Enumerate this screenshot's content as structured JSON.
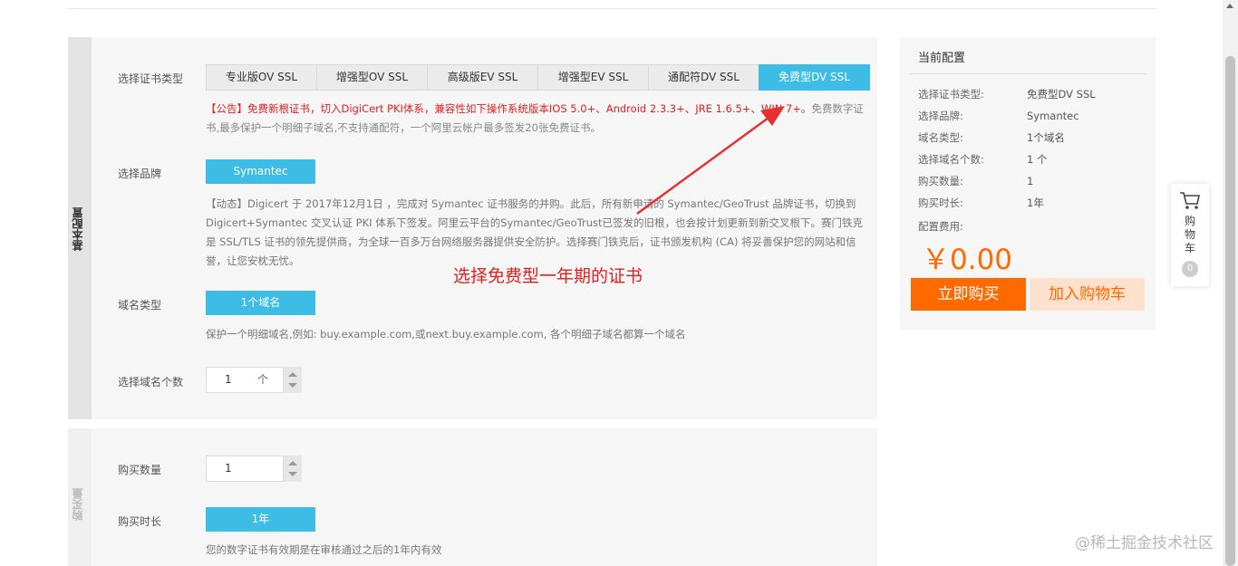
{
  "config": {
    "section1_label": "基本配置",
    "section2_label": "购买量",
    "cert_type_label": "选择证书类型",
    "cert_types": [
      "专业版OV SSL",
      "增强型OV SSL",
      "高级版EV SSL",
      "增强型EV SSL",
      "通配符DV SSL",
      "免费型DV SSL"
    ],
    "active_cert_type_index": 5,
    "notice_red": "【公告】免费新根证书，切入DigiCert PKI体系，兼容性如下操作系统版本IOS 5.0+、Android 2.3.3+、JRE 1.6.5+、WIN 7+。",
    "notice_grey": "免费数字证书,最多保护一个明细子域名,不支持通配符，一个阿里云帐户最多签发20张免费证书。",
    "brand_label": "选择品牌",
    "brand_value": "Symantec",
    "brand_notice": "【动态】Digicert 于 2017年12月1日 ，完成对 Symantec 证书服务的并购。此后，所有新申请的 Symantec/GeoTrust 品牌证书，切换到 Digicert+Symantec 交叉认证 PKI 体系下签发。阿里云平台的Symantec/GeoTrust已签发的旧根，也会按计划更新到新交叉根下。赛门铁克是 SSL/TLS 证书的领先提供商，为全球一百多万台网络服务器提供安全防护。选择赛门铁克后，证书颁发机构 (CA) 将妥善保护您的网站和信誉，让您安枕无忧。",
    "domain_type_label": "域名类型",
    "domain_type_value": "1个域名",
    "domain_type_hint": "保护一个明细域名,例如: buy.example.com,或next.buy.example.com, 各个明细子域名都算一个域名",
    "domain_count_label": "选择域名个数",
    "domain_count_value": "1",
    "domain_count_unit": "个",
    "quantity_label": "购买数量",
    "quantity_value": "1",
    "duration_label": "购买时长",
    "duration_value": "1年",
    "duration_hint": "您的数字证书有效期是在审核通过之后的1年内有效"
  },
  "annotation": {
    "text": "选择免费型一年期的证书"
  },
  "summary": {
    "title": "当前配置",
    "rows": [
      {
        "key": "选择证书类型:",
        "value": "免费型DV SSL"
      },
      {
        "key": "选择品牌:",
        "value": "Symantec"
      },
      {
        "key": "域名类型:",
        "value": "1个域名"
      },
      {
        "key": "选择域名个数:",
        "value": "1 个"
      },
      {
        "key": "购买数量:",
        "value": "1"
      },
      {
        "key": "购买时长:",
        "value": "1年"
      }
    ],
    "fee_label": "配置费用:",
    "price": "￥0.00",
    "buy_now": "立即购买",
    "add_cart": "加入购物车"
  },
  "floating_cart": {
    "label": "购物车",
    "count": "0"
  },
  "watermark": "@稀土掘金技术社区",
  "colors": {
    "accent_blue": "#3dbde6",
    "accent_orange": "#ff6a00",
    "notice_red": "#e02020"
  }
}
